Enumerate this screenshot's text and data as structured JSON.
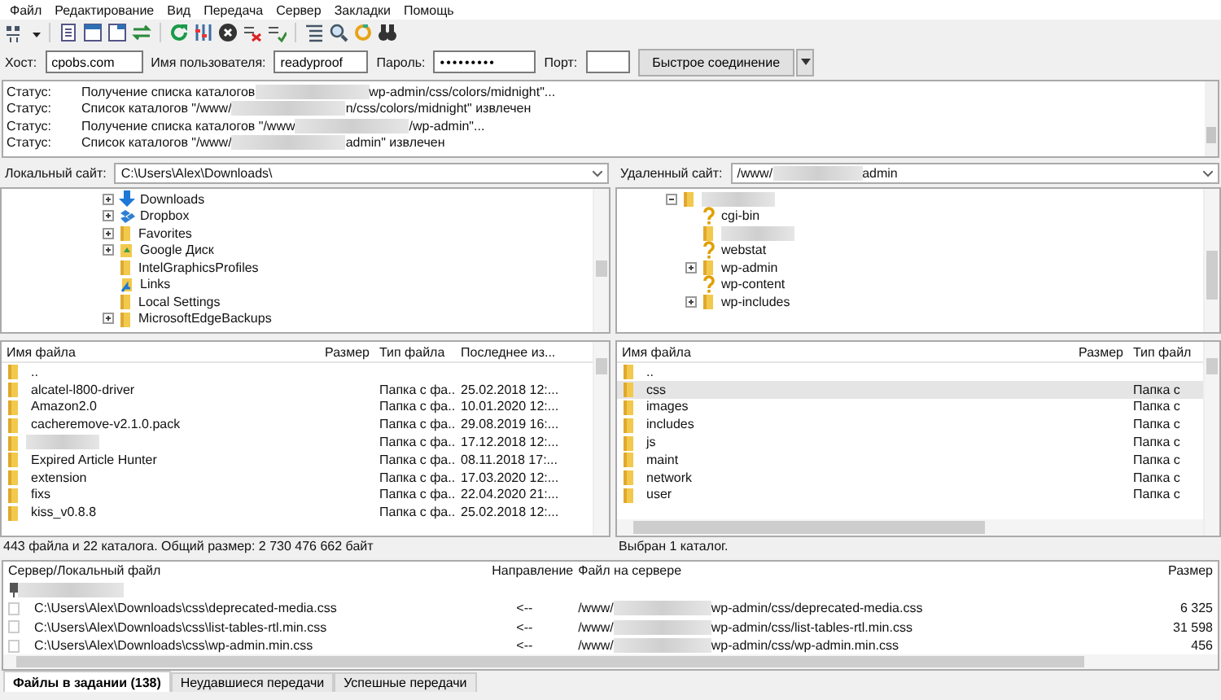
{
  "menu": [
    "Файл",
    "Редактирование",
    "Вид",
    "Передача",
    "Сервер",
    "Закладки",
    "Помощь"
  ],
  "quickconnect": {
    "host": {
      "label": "Хост:",
      "value": "cpobs.com"
    },
    "user": {
      "label": "Имя пользователя:",
      "value": "readyproof"
    },
    "password": {
      "label": "Пароль:",
      "value": "•••••••••"
    },
    "port": {
      "label": "Порт:"
    },
    "button": "Быстрое соединение"
  },
  "log": [
    {
      "label": "Статус:",
      "before": "Получение списка каталогов ",
      "after": "wp-admin/css/colors/midnight\"...",
      "redacted": true
    },
    {
      "label": "Статус:",
      "before": "Список каталогов \"/www/",
      "after": "n/css/colors/midnight\" извлечен",
      "redacted": true
    },
    {
      "label": "Статус:",
      "before": "Получение списка каталогов \"/www",
      "after": "/wp-admin\"...",
      "redacted": true
    },
    {
      "label": "Статус:",
      "before": "Список каталогов \"/www/",
      "after": "admin\" извлечен",
      "redacted": true
    }
  ],
  "local": {
    "site_label": "Локальный сайт:",
    "path": "C:\\Users\\Alex\\Downloads\\",
    "tree": [
      {
        "name": "Downloads",
        "kind": "download",
        "expanded": false
      },
      {
        "name": "Dropbox",
        "kind": "dropbox",
        "expanded": false
      },
      {
        "name": "Favorites",
        "kind": "folder",
        "expanded": false
      },
      {
        "name": "Google Диск",
        "kind": "gdrive",
        "expanded": false
      },
      {
        "name": "IntelGraphicsProfiles",
        "kind": "folder"
      },
      {
        "name": "Links",
        "kind": "link"
      },
      {
        "name": "Local Settings",
        "kind": "folder"
      },
      {
        "name": "MicrosoftEdgeBackups",
        "kind": "folder",
        "expanded": false
      }
    ],
    "columns": [
      "Имя файла",
      "Размер",
      "Тип файла",
      "Последнее из..."
    ],
    "rows": [
      {
        "name": "..",
        "selected": false
      },
      {
        "name": "alcatel-l800-driver",
        "type": "Папка с фа...",
        "modified": "25.02.2018 12:...",
        "selected": false
      },
      {
        "name": "Amazon2.0",
        "type": "Папка с фа...",
        "modified": "10.01.2020 12:...",
        "selected": false
      },
      {
        "name": "cacheremove-v2.1.0.pack",
        "type": "Папка с фа...",
        "modified": "29.08.2019 16:...",
        "selected": false
      },
      {
        "redacted": true,
        "type": "Папка с фа...",
        "modified": "17.12.2018 12:...",
        "selected": false
      },
      {
        "name": "Expired Article Hunter",
        "type": "Папка с фа...",
        "modified": "08.11.2018 17:...",
        "selected": false
      },
      {
        "name": "extension",
        "type": "Папка с фа...",
        "modified": "17.03.2020 12:...",
        "selected": false
      },
      {
        "name": "fixs",
        "type": "Папка с фа...",
        "modified": "22.04.2020 21:...",
        "selected": false
      },
      {
        "name": "kiss_v0.8.8",
        "type": "Папка с фа...",
        "modified": "25.02.2018 12:...",
        "selected": false
      }
    ],
    "summary": "443 файла и 22 каталога. Общий размер: 2 730 476 662 байт"
  },
  "remote": {
    "site_label": "Удаленный сайт:",
    "path_before": "/www/",
    "path_after": "admin",
    "redacted": true,
    "tree": [
      {
        "redacted": true,
        "kind": "folder",
        "expanded": true,
        "children": [
          {
            "name": "cgi-bin",
            "kind": "unknown"
          },
          {
            "redacted": true,
            "kind": "folder"
          },
          {
            "name": "webstat",
            "kind": "unknown"
          },
          {
            "name": "wp-admin",
            "kind": "folder",
            "expanded": false
          },
          {
            "name": "wp-content",
            "kind": "unknown"
          },
          {
            "name": "wp-includes",
            "kind": "folder",
            "expanded": false
          }
        ]
      }
    ],
    "columns": [
      "Имя файла",
      "Размер",
      "Тип файл"
    ],
    "rows": [
      {
        "name": "..",
        "selected": false
      },
      {
        "name": "css",
        "type": "Папка с",
        "selected": true
      },
      {
        "name": "images",
        "type": "Папка с",
        "selected": false
      },
      {
        "name": "includes",
        "type": "Папка с",
        "selected": false
      },
      {
        "name": "js",
        "type": "Папка с",
        "selected": false
      },
      {
        "name": "maint",
        "type": "Папка с",
        "selected": false
      },
      {
        "name": "network",
        "type": "Папка с",
        "selected": false
      },
      {
        "name": "user",
        "type": "Папка с",
        "selected": false
      }
    ],
    "summary": "Выбран 1 каталог."
  },
  "queue": {
    "columns": [
      "Сервер/Локальный файл",
      "Направление",
      "Файл на сервере",
      "Размер"
    ],
    "server": {
      "redacted": true
    },
    "rows": [
      {
        "local": "C:\\Users\\Alex\\Downloads\\css\\deprecated-media.css",
        "direction": "<--",
        "remote_before": "/www/",
        "remote_after": "wp-admin/css/deprecated-media.css",
        "size": "6 325"
      },
      {
        "local": "C:\\Users\\Alex\\Downloads\\css\\list-tables-rtl.min.css",
        "direction": "<--",
        "remote_before": "/www/",
        "remote_after": "wp-admin/css/list-tables-rtl.min.css",
        "size": "31 598"
      },
      {
        "local": "C:\\Users\\Alex\\Downloads\\css\\wp-admin.min.css",
        "direction": "<--",
        "remote_before": "/www/",
        "remote_after": "wp-admin/css/wp-admin.min.css",
        "size": "456"
      }
    ]
  },
  "tabs": [
    {
      "label": "Файлы в задании (138)",
      "selected": true
    },
    {
      "label": "Неудавшиеся передачи",
      "selected": false
    },
    {
      "label": "Успешные передачи",
      "selected": false
    }
  ]
}
